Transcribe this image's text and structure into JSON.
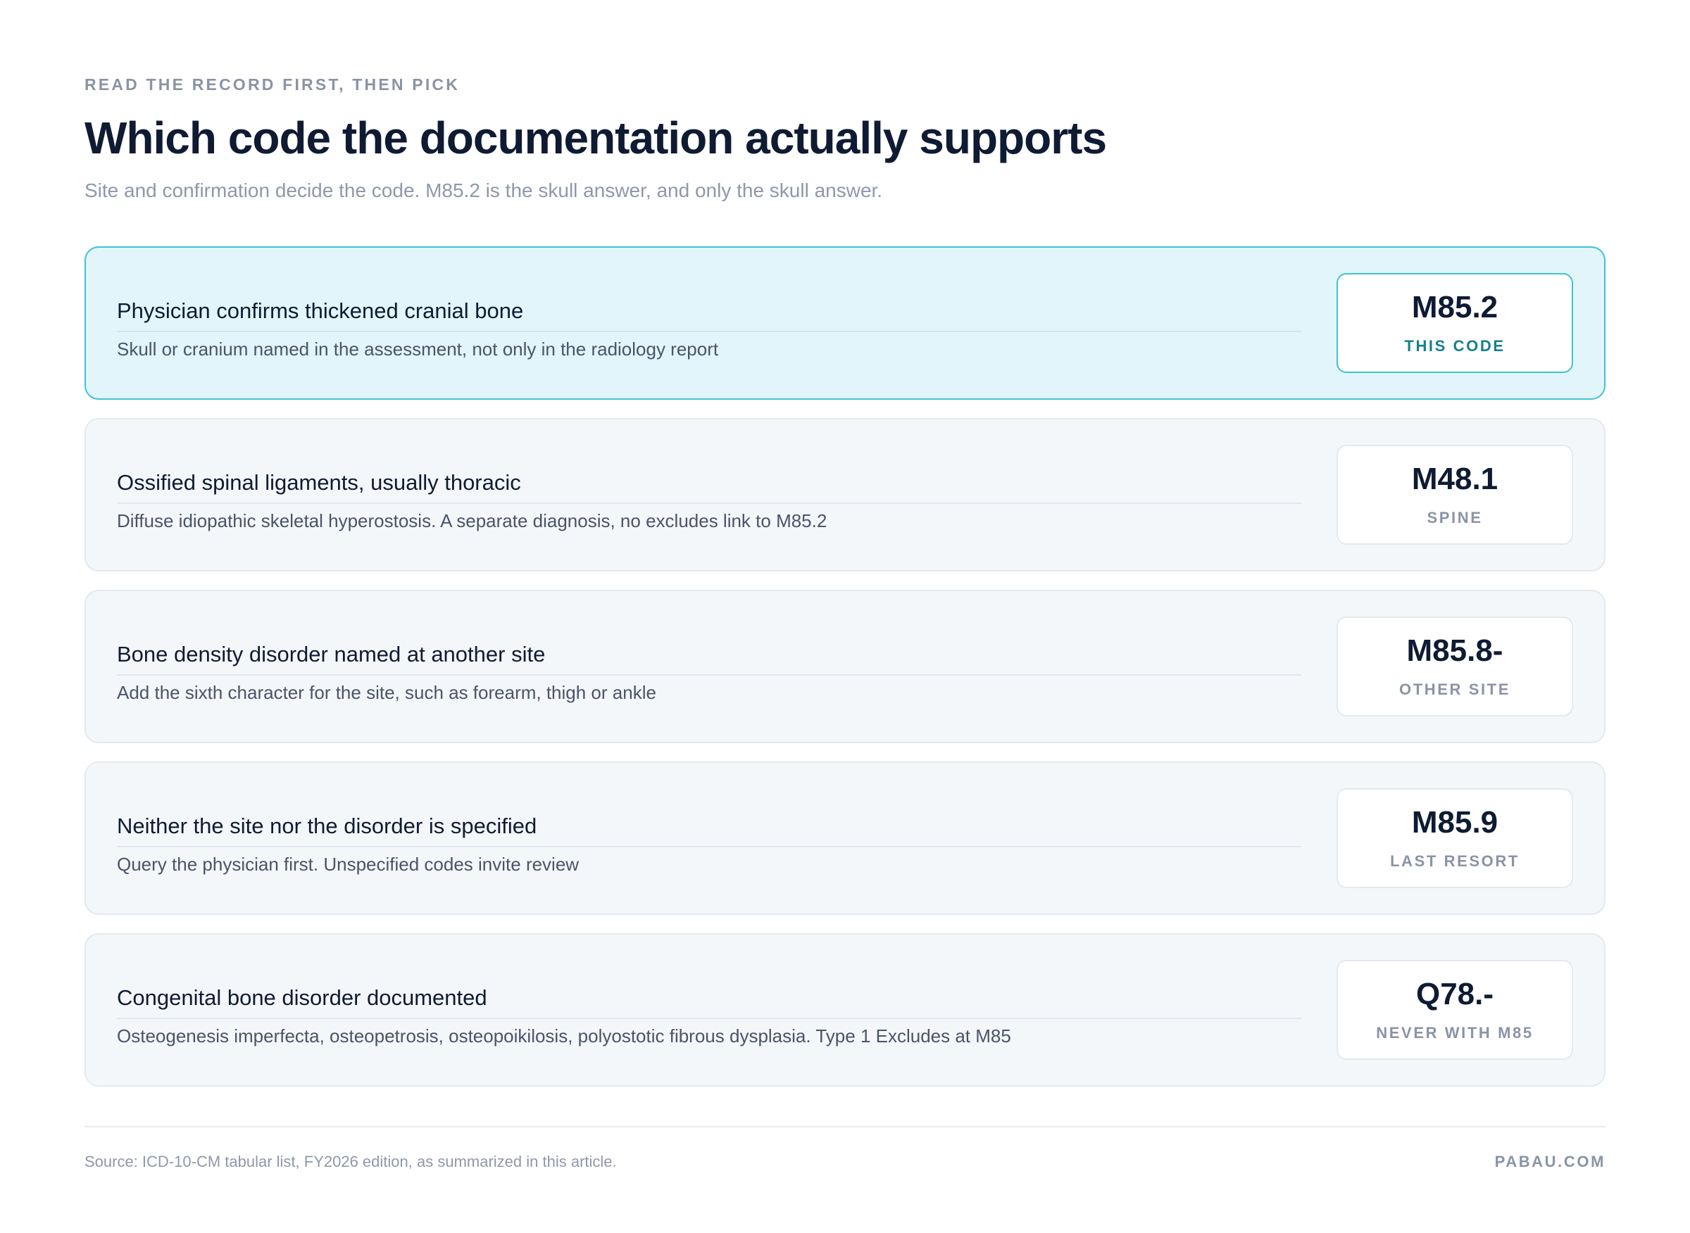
{
  "header": {
    "eyebrow": "READ THE RECORD FIRST, THEN PICK",
    "title": "Which code the documentation actually supports",
    "subtitle": "Site and confirmation decide the code. M85.2 is the skull answer, and only the skull answer."
  },
  "options": [
    {
      "heading": "Physician confirms thickened cranial bone",
      "description": "Skull or cranium named in the assessment, not only in the radiology report",
      "code": "M85.2",
      "label": "THIS CODE",
      "selected": true
    },
    {
      "heading": "Ossified spinal ligaments, usually thoracic",
      "description": "Diffuse idiopathic skeletal hyperostosis. A separate diagnosis, no excludes link to M85.2",
      "code": "M48.1",
      "label": "SPINE",
      "selected": false
    },
    {
      "heading": "Bone density disorder named at another site",
      "description": "Add the sixth character for the site, such as forearm, thigh or ankle",
      "code": "M85.8-",
      "label": "OTHER SITE",
      "selected": false
    },
    {
      "heading": "Neither the site nor the disorder is specified",
      "description": "Query the physician first. Unspecified codes invite review",
      "code": "M85.9",
      "label": "LAST RESORT",
      "selected": false
    },
    {
      "heading": "Congenital bone disorder documented",
      "description": "Osteogenesis imperfecta, osteopetrosis, osteopoikilosis, polyostotic fibrous dysplasia. Type 1 Excludes at M85",
      "code": "Q78.-",
      "label": "NEVER WITH M85",
      "selected": false
    }
  ],
  "footer": {
    "source": "Source: ICD-10-CM tabular list, FY2026 edition, as summarized in this article.",
    "brand": "PABAU.COM"
  },
  "colors": {
    "selected_background": "#e2f5fa",
    "selected_border": "#3ec3d2",
    "selected_label": "#14808c",
    "card_background": "#f4f7fa",
    "heading_text": "#0f1b33",
    "muted_text": "#8a93a6"
  }
}
